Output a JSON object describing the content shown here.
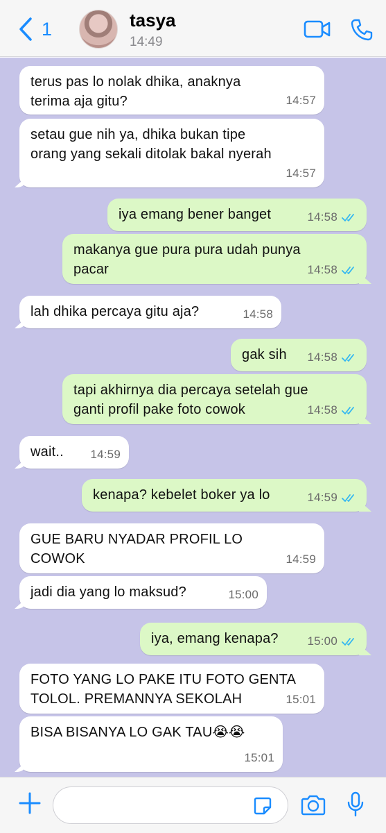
{
  "header": {
    "back_count": "1",
    "contact_name": "tasya",
    "last_seen": "14:49",
    "icons": [
      "chevron-left-icon",
      "avatar",
      "video-call-icon",
      "phone-call-icon"
    ]
  },
  "messages": [
    {
      "dir": "in",
      "text": "terus pas lo nolak dhika, anaknya\nterima aja gitu?",
      "time": "14:57"
    },
    {
      "dir": "in",
      "text": "setau gue nih ya, dhika bukan tipe\norang yang sekali ditolak bakal nyerah",
      "time": "14:57"
    },
    {
      "dir": "out",
      "text": "iya emang bener banget",
      "time": "14:58",
      "read": true
    },
    {
      "dir": "out",
      "text": "makanya gue pura pura udah punya\npacar",
      "time": "14:58",
      "read": true
    },
    {
      "dir": "in",
      "text": "lah dhika percaya gitu aja?",
      "time": "14:58"
    },
    {
      "dir": "out",
      "text": "gak sih",
      "time": "14:58",
      "read": true
    },
    {
      "dir": "out",
      "text": "tapi akhirnya dia percaya setelah gue\nganti profil pake foto cowok",
      "time": "14:58",
      "read": true
    },
    {
      "dir": "in",
      "text": "wait..",
      "time": "14:59"
    },
    {
      "dir": "out",
      "text": "kenapa? kebelet boker ya lo",
      "time": "14:59",
      "read": true
    },
    {
      "dir": "in",
      "text": "GUE BARU NYADAR PROFIL LO\nCOWOK",
      "time": "14:59"
    },
    {
      "dir": "in",
      "text": "jadi dia yang lo maksud?",
      "time": "15:00"
    },
    {
      "dir": "out",
      "text": "iya, emang kenapa?",
      "time": "15:00",
      "read": true
    },
    {
      "dir": "in",
      "text": "FOTO YANG LO PAKE ITU FOTO GENTA\nTOLOL. PREMANNYA SEKOLAH",
      "time": "15:01"
    },
    {
      "dir": "in",
      "text": "BISA BISANYA LO GAK TAU😭😭",
      "time": "15:01"
    }
  ],
  "input": {
    "value": "",
    "placeholder": ""
  },
  "colors": {
    "chat_bg": "#c6c4e8",
    "incoming": "#ffffff",
    "outgoing": "#dcf8c6",
    "accent": "#1a8cff",
    "read_ticks": "#34b7f1"
  }
}
